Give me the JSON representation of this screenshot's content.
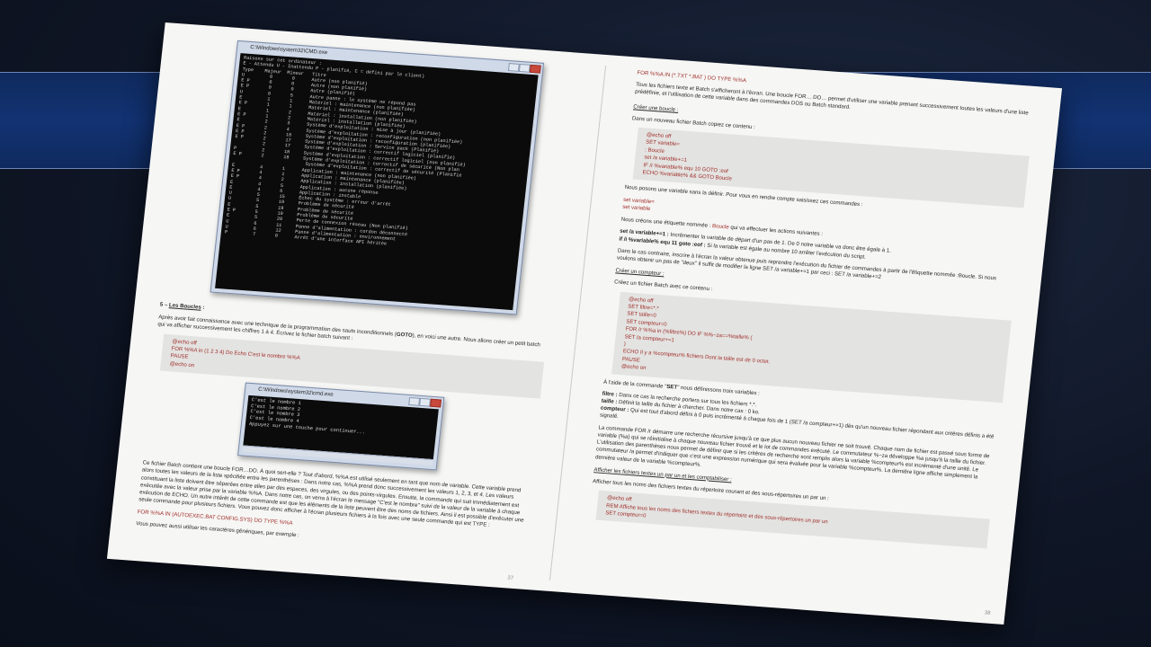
{
  "left_page": {
    "cmd_large": {
      "title": "C:\\Windows\\system32\\CMD.exe",
      "lines": [
        "Raisons sur cet ordinateur :",
        "E - Attendu U - Inattendu P - planifié, C = défini par le client)",
        "Type    Majeur  Mineur   Titre",
        "",
        "U         0       0      Autre (non planifié)",
        "E P       0       0      Autre (non planifié)",
        "E P       0       0      Autre (planifié)",
        "U         0       5      Autre panne : le système ne répond pas",
        "E         1       1      Matériel : maintenance (non planifiée)",
        "E P       1       1      Matériel : maintenance (planifiée)",
        "E         1       2      Matériel : installation (non planifiée)",
        "E P       1       2      Matériel : installation (planifiée)",
        "E         2       3      Système d'exploitation : mise à jour (planifiée)",
        "E P       2       4      Système d'exploitation : reconfiguration (non planifiée)",
        "E P       2       16     Système d'exploitation : reconfiguration (planifiée)",
        "E P       2       17     Système d'exploitation : Service pack (Planifié)",
        "          2       17     Système d'exploitation : correctif logiciel (planifié)",
        "P         2       18     Système d'exploitation : correctif logiciel (non planifié)",
        "E P       2       18     Système d'exploitation : correctif de sécurité (Non plan",
        "",
        "                          Système d'exploitation : correctif de sécurité (Planifié",
        "E         4       1      Application : maintenance (non planifiée)",
        "E P       4       1      Application : maintenance (planifiée)",
        "E P       4       2      Application : installation (planifiée)",
        "E         4       5      Application : aucune réponse",
        "E         4       6      Application : instable",
        "U         5       15     Échec du système : erreur d'arrêt",
        "U         5       19     Problème de sécurité",
        "E         5       19     Problème de sécurité",
        "E P       5       19     Problème de sécurité",
        "E         5       20     Perte de connexion réseau (Non planifié)",
        "U         6       11     Panne d'alimentation : cordon déconnecté",
        "U         6       12     Panne d'alimentation : environnement",
        "P         7       0      Arrêt d'une interface API héritée"
      ]
    },
    "section_heading_prefix": "5 – ",
    "section_heading": "Les Boucles",
    "section_heading_suffix": " :",
    "intro_p1": "Après avoir fait connaissance avec une technique de la programmation des sauts inconditionnels (",
    "intro_goto": "GOTO",
    "intro_p2": "), en voici une autre. Nous allons créer un petit batch qui va afficher successivement les chiffres 1 à 4. Écrivez le fichier batch suivant :",
    "code1": [
      "@echo off",
      "FOR %%A in (1 2 3 4) Do Echo C'est le nombre %%A",
      "PAUSE",
      "@echo on"
    ],
    "cmd_small": {
      "title": "C:\\Windows\\system32\\cmd.exe",
      "lines": [
        "C'est le nombre 1",
        "C'est le nombre 2",
        "C'est le nombre 3",
        "C'est le nombre 4",
        "Appuyez sur une touche pour continuer..."
      ]
    },
    "para_for": "Ce fichier Batch contient une boucle FOR…DO. À quoi sert-elle ? Tout d'abord, %%A est utilisé seulement en tant que nom de variable. Cette variable prend alors toutes les valeurs de la liste spécifiée entre les parenthèses : Dans notre cas, %%A prend donc successivement les valeurs 1, 2, 3, et 4. Les valeurs constituant la liste doivent être séparées entre elles par des espaces, des virgules, ou des points-virgules. Ensuite, la commande qui suit immédiatement est exécutée avec la valeur prise par la variable %%A. Dans notre cas, on verra à l'écran le message \"C'est le nombre\" suivi de la valeur de la variable à chaque exécution de ECHO. Un autre intérêt de cette commande est que les éléments de la liste peuvent être des noms de fichiers. Ainsi il est possible d'exécuter une seule commande pour plusieurs fichiers. Vous pouvez donc afficher à l'écran plusieurs fichiers à la fois avec une seule commande qui est TYPE :",
    "code_type": "FOR %%A IN (AUTOEXEC.BAT CONFIG.SYS) DO TYPE %%A",
    "para_generic": "Vous pouvez aussi utiliser les caractères génériques, par exemple :",
    "page_number": "37"
  },
  "right_page": {
    "code_top": "FOR %%A IN (*.TXT *.BAT ) DO TYPE %%A",
    "para_top": "Tous les fichiers texte et Batch s'afficheront à l'écran. Une boucle FOR… DO… permet d'utiliser une variable prenant successivement toutes les valeurs d'une liste prédéfinie, et l'utilisation de cette variable dans des commandes DOS ou Batch standard.",
    "heading_boucle": "Créer une boucle :",
    "p_boucle": "Dans un nouveau fichier Batch copiez ce contenu :",
    "code_boucle": [
      "@echo off",
      "SET variable=",
      ": Boucle",
      "set /a variable+=1",
      "IF /I %variable% equ 10 GOTO :eof",
      "ECHO %variable% && GOTO Boucle"
    ],
    "p_posons": "Nous posons une variable sans la définir. Pour vous en rendre compte saisissez ces commandes :",
    "code_posons": [
      "set variable=",
      "set variable"
    ],
    "p_etiquette_a": "Nous créons une étiquette nommée : ",
    "p_etiquette_b": "Boucle",
    "p_etiquette_c": " qui va effectuer les actions suivantes :",
    "p_incr_code": "set /a variable+=1 :",
    "p_incr_text": " Incrémenter la variable de départ d'un pas de 1. De 0 notre variable va donc être égale à 1.",
    "p_if_code": "if /i %variable% equ 11 goto :eof :",
    "p_if_text": " Si la variable est égale au nombre 10 arrêter l'exécution du script.",
    "p_contraire": "Dans le cas contraire, inscrire à l'écran la valeur obtenue puis reprendre l'exécution du fichier de commandes à partir de l'étiquette nommée :Boucle. Si nous voulons obtenir un pas de \"deux\" il suffit de modifier la ligne SET /a variable+=1 par ceci : SET /a variable+=2",
    "heading_compteur": "Créer un compteur :",
    "p_compteur": "Créez un fichier Batch avec ce contenu :",
    "code_compteur": [
      "@echo off",
      "SET filtre=*.*",
      "SET taille=0",
      "SET compteur=0",
      "FOR /r %%a in (%filtre%) DO IF %%~za==%taille% (",
      "SET /a compteur+=1",
      ")",
      "ECHO Il y a %compteur% fichiers Dont la taille est de 0 octet.",
      "PAUSE",
      "@echo on"
    ],
    "p_set_a": "À l'aide de la commande \"",
    "p_set_b": "SET",
    "p_set_c": "\" nous définissons trois variables :",
    "def_filtre_k": "filtre :",
    "def_filtre_v": " Dans ce cas la recherche portera sur tous les fichiers *.*.",
    "def_taille_k": "taille :",
    "def_taille_v": " Définit la taille du fichier à chercher. Dans notre cas : 0 ko.",
    "def_compteur_k": "compteur :",
    "def_compteur_v": " Qui est tout d'abord défini à 0 puis incrémenté à chaque fois de 1 (SET /a compteur+=1) dès qu'un nouveau fichier répondant aux critères définis a été signalé.",
    "p_for_r": "La commande FOR /r démarre une recherche récursive jusqu'à ce que plus aucun nouveau fichier ne soit trouvé. Chaque nom de fichier est passé sous forme de variable (%a) qui se réinitialise à chaque nouveau fichier trouvé et le lot de commandes exécuté. Le commutateur %~za développe %a jusqu'à la taille du fichier. L'utilisation des parenthèses nous permet de définir que si les critères de recherche sont remplis alors la variable %compteur% est incrémenté d'une unité. Le commutateur /a permet d'indiquer que c'est une expression numérique qui sera évaluée pour la variable %compteur%. La dernière ligne affiche simplement la dernière valeur de la variable %compteur%.",
    "heading_afficher": "Afficher les fichiers textes un par un et les comptabiliser :",
    "p_afficher": "Afficher tous les noms des fichiers textes du répertoire courant et des sous-répertoires un par un :",
    "code_afficher": [
      "@echo off",
      "REM Affiche tous les noms des fichiers textes du répertoire et des sous-répertoires un par un",
      "SET compteur=0"
    ],
    "page_number": "38"
  }
}
